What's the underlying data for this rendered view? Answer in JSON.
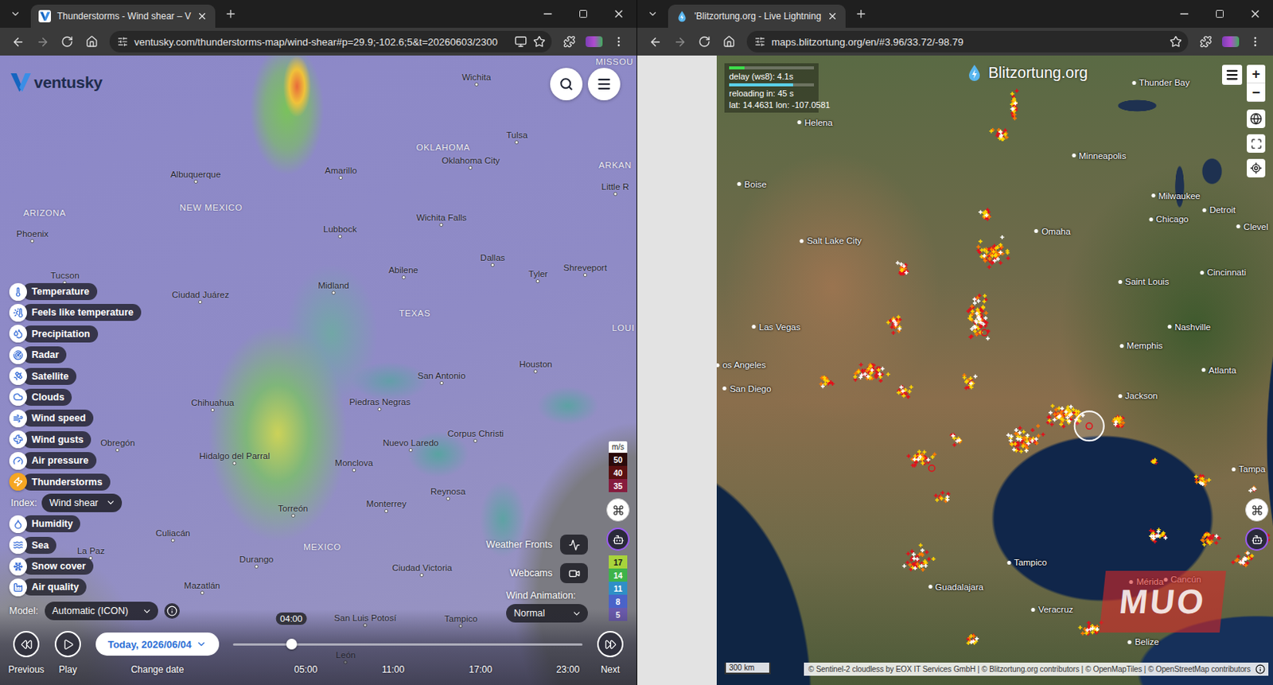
{
  "windows": [
    {
      "tab": {
        "title": "Thunderstorms - Wind shear – V",
        "selected": true
      },
      "url": "ventusky.com/thunderstorms-map/wind-shear#p=29.9;-102.6;5&t=20260603/2300"
    },
    {
      "tab": {
        "title": "'Blitzortung.org - Live Lightning",
        "selected": true
      },
      "url": "maps.blitzortung.org/en/#3.96/33.72/-98.79"
    }
  ],
  "ventusky": {
    "logo": "ventusky",
    "map_labels": [
      {
        "text": "MISSOU",
        "kind": "region"
      },
      {
        "text": "Wichita",
        "kind": "city"
      },
      {
        "text": "Tulsa",
        "kind": "city"
      },
      {
        "text": "OKLAHOMA",
        "kind": "region"
      },
      {
        "text": "Oklahoma City",
        "kind": "city"
      },
      {
        "text": "ARKAN",
        "kind": "region"
      },
      {
        "text": "Little R",
        "kind": "city"
      },
      {
        "text": "Albuquerque",
        "kind": "city"
      },
      {
        "text": "Amarillo",
        "kind": "city"
      },
      {
        "text": "NEW MEXICO",
        "kind": "region"
      },
      {
        "text": "ARIZONA",
        "kind": "region"
      },
      {
        "text": "Phoenix",
        "kind": "city"
      },
      {
        "text": "Lubbock",
        "kind": "city"
      },
      {
        "text": "Wichita Falls",
        "kind": "city"
      },
      {
        "text": "Dallas",
        "kind": "city"
      },
      {
        "text": "Tyler",
        "kind": "city"
      },
      {
        "text": "Shreveport",
        "kind": "city"
      },
      {
        "text": "LOUI",
        "kind": "region"
      },
      {
        "text": "Tucson",
        "kind": "city"
      },
      {
        "text": "Ciudad Juárez",
        "kind": "city"
      },
      {
        "text": "Midland",
        "kind": "city"
      },
      {
        "text": "Abilene",
        "kind": "city"
      },
      {
        "text": "TEXAS",
        "kind": "region"
      },
      {
        "text": "Houston",
        "kind": "city"
      },
      {
        "text": "San Antonio",
        "kind": "city"
      },
      {
        "text": "Chihuahua",
        "kind": "city"
      },
      {
        "text": "Piedras Negras",
        "kind": "city"
      },
      {
        "text": "Nuevo Laredo",
        "kind": "city"
      },
      {
        "text": "Corpus Christi",
        "kind": "city"
      },
      {
        "text": "Hidalgo del Parral",
        "kind": "city"
      },
      {
        "text": "Monclova",
        "kind": "city"
      },
      {
        "text": "Obregón",
        "kind": "city"
      },
      {
        "text": "Reynosa",
        "kind": "city"
      },
      {
        "text": "Torreón",
        "kind": "city"
      },
      {
        "text": "Monterrey",
        "kind": "city"
      },
      {
        "text": "Culiacán",
        "kind": "city"
      },
      {
        "text": "Durango",
        "kind": "city"
      },
      {
        "text": "MEXICO",
        "kind": "region"
      },
      {
        "text": "Ciudad Victoria",
        "kind": "city"
      },
      {
        "text": "Mazatlán",
        "kind": "city"
      },
      {
        "text": "La Paz",
        "kind": "city"
      },
      {
        "text": "San Luis Potosí",
        "kind": "city"
      },
      {
        "text": "Tampico",
        "kind": "city"
      },
      {
        "text": "León",
        "kind": "city"
      }
    ],
    "layers": [
      {
        "kind": "layer",
        "label": "Temperature",
        "selected": false
      },
      {
        "kind": "layer",
        "label": "Feels like temperature",
        "selected": false
      },
      {
        "kind": "layer",
        "label": "Precipitation",
        "selected": false
      },
      {
        "kind": "layer",
        "label": "Radar",
        "selected": false
      },
      {
        "kind": "layer",
        "label": "Satellite",
        "selected": false
      },
      {
        "kind": "layer",
        "label": "Clouds",
        "selected": false
      },
      {
        "kind": "layer",
        "label": "Wind speed",
        "selected": false
      },
      {
        "kind": "layer",
        "label": "Wind gusts",
        "selected": false
      },
      {
        "kind": "layer",
        "label": "Air pressure",
        "selected": false
      },
      {
        "kind": "layer",
        "label": "Thunderstorms",
        "selected": true
      },
      {
        "kind": "index",
        "label": "Index:",
        "value": "Wind shear"
      },
      {
        "kind": "layer",
        "label": "Humidity",
        "selected": false
      },
      {
        "kind": "layer",
        "label": "Sea",
        "selected": false
      },
      {
        "kind": "layer",
        "label": "Snow cover",
        "selected": false
      },
      {
        "kind": "layer",
        "label": "Air quality",
        "selected": false
      }
    ],
    "model": {
      "label": "Model:",
      "value": "Automatic (ICON)"
    },
    "toggles": [
      {
        "label": "Weather Fronts"
      },
      {
        "label": "Webcams"
      }
    ],
    "wind_animation": {
      "label": "Wind Animation:",
      "value": "Normal"
    },
    "legend": {
      "unit": "m/s",
      "upper": [
        {
          "value": "50",
          "color": "#2b0a0a"
        },
        {
          "value": "40",
          "color": "#5a1010"
        },
        {
          "value": "35",
          "color": "#861c3e"
        }
      ],
      "lower": [
        {
          "value": "17",
          "color": "#a8d43b"
        },
        {
          "value": "14",
          "color": "#3eb34a"
        },
        {
          "value": "11",
          "color": "#2f8fc6"
        },
        {
          "value": "8",
          "color": "#4a63c9"
        },
        {
          "value": "5",
          "color": "#6a5aad"
        }
      ]
    },
    "timeline": {
      "previous": "Previous",
      "play": "Play",
      "date": "Today, 2026/06/04",
      "change_date": "Change date",
      "next": "Next",
      "current": "04:00",
      "level": 0.1667,
      "ticks": [
        "05:00",
        "11:00",
        "17:00",
        "23:00"
      ]
    }
  },
  "blitzortung": {
    "logo": "Blitzortung.org",
    "stats": [
      {
        "text": "delay (ws8): 4.1s",
        "level": 0.18,
        "color": "#3ddc4a"
      },
      {
        "text": "reloading in: 45 s",
        "level": 0.75,
        "color": "#5ad0e8"
      }
    ],
    "position": "lat: 14.4631 lon: -107.0581",
    "map_labels": [
      "Thunder Bay",
      "Helena",
      "Minneapolis",
      "Boise",
      "Milwaukee",
      "Detroit",
      "Chicago",
      "Clevel",
      "Omaha",
      "Salt Lake City",
      "Cincinnati",
      "Saint Louis",
      "Las Vegas",
      "Nashville",
      "Memphis",
      "os Angeles",
      "Atlanta",
      "San Diego",
      "Jackson",
      "Tampa",
      "Tampico",
      "Guadalajara",
      "Veracruz",
      "Mérida",
      "Cancún",
      "Belize"
    ],
    "zoom": [
      "+",
      "−"
    ],
    "scale": "300 km",
    "attribution": "© Sentinel-2 cloudless by EOX IT Services GmbH | © Blitzortung.org contributors | © OpenMapTiles | © OpenStreetMap contributors",
    "watermark": "MUO"
  }
}
